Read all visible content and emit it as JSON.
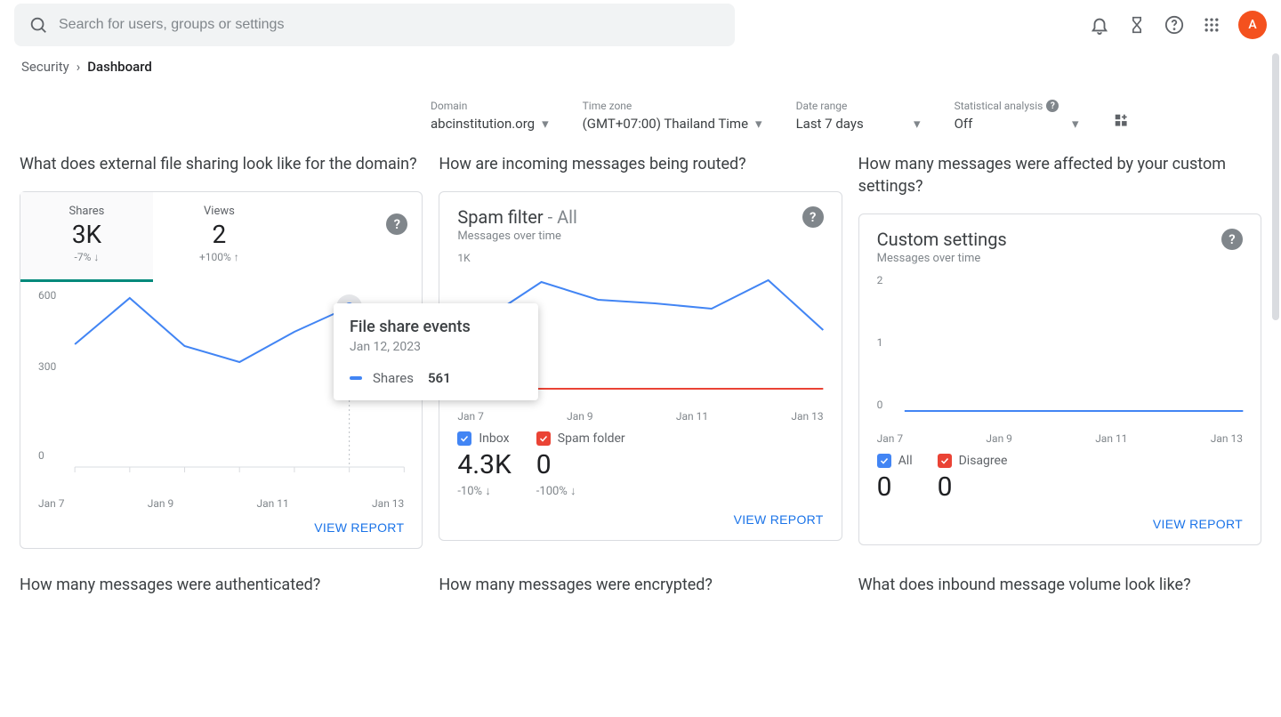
{
  "header": {
    "search_placeholder": "Search for users, groups or settings",
    "avatar_letter": "A"
  },
  "breadcrumb": {
    "parent": "Security",
    "current": "Dashboard"
  },
  "filters": {
    "domain": {
      "label": "Domain",
      "value": "abcinstitution.org"
    },
    "timezone": {
      "label": "Time zone",
      "value": "(GMT+07:00) Thailand Time"
    },
    "daterange": {
      "label": "Date range",
      "value": "Last 7 days"
    },
    "stats": {
      "label": "Statistical analysis",
      "value": "Off"
    }
  },
  "cards": {
    "fileSharing": {
      "question": "What does external file sharing look like for the domain?",
      "tabs": [
        {
          "label": "Shares",
          "value": "3K",
          "delta": "-7% ↓"
        },
        {
          "label": "Views",
          "value": "2",
          "delta": "+100% ↑"
        }
      ],
      "xTicks": [
        "Jan 7",
        "Jan 9",
        "Jan 11",
        "Jan 13"
      ],
      "yTicks": [
        "600",
        "300",
        "0"
      ],
      "view": "VIEW REPORT",
      "tooltip": {
        "title": "File share events",
        "date": "Jan 12, 2023",
        "series": "Shares",
        "value": "561"
      }
    },
    "spam": {
      "question": "How are incoming messages being routed?",
      "title": "Spam filter",
      "suffix": " - All",
      "sub": "Messages over time",
      "yTicks": [
        "1K"
      ],
      "xTicks": [
        "Jan 7",
        "Jan 9",
        "Jan 11",
        "Jan 13"
      ],
      "legend": [
        {
          "name": "Inbox",
          "value": "4.3K",
          "delta": "-10% ↓",
          "color": "blue"
        },
        {
          "name": "Spam folder",
          "value": "0",
          "delta": "-100% ↓",
          "color": "red"
        }
      ],
      "view": "VIEW REPORT"
    },
    "custom": {
      "question": "How many messages were affected by your custom settings?",
      "title": "Custom settings",
      "sub": "Messages over time",
      "yTicks": [
        "2",
        "1",
        "0"
      ],
      "xTicks": [
        "Jan 7",
        "Jan 9",
        "Jan 11",
        "Jan 13"
      ],
      "legend": [
        {
          "name": "All",
          "value": "0",
          "color": "blue"
        },
        {
          "name": "Disagree",
          "value": "0",
          "color": "red"
        }
      ],
      "view": "VIEW REPORT"
    }
  },
  "row2": {
    "q1": "How many messages were authenticated?",
    "q2": "How many messages were encrypted?",
    "q3": "What does inbound message volume look like?"
  },
  "chart_data": [
    {
      "type": "line",
      "title": "File share events – Shares",
      "xlabel": "",
      "ylabel": "",
      "x": [
        "Jan 7",
        "Jan 8",
        "Jan 9",
        "Jan 10",
        "Jan 11",
        "Jan 12",
        "Jan 13"
      ],
      "series": [
        {
          "name": "Shares",
          "values": [
            420,
            590,
            420,
            360,
            470,
            561,
            400
          ]
        }
      ],
      "ylim": [
        0,
        600
      ]
    },
    {
      "type": "line",
      "title": "Spam filter – Messages over time",
      "x": [
        "Jan 7",
        "Jan 8",
        "Jan 9",
        "Jan 10",
        "Jan 11",
        "Jan 12",
        "Jan 13"
      ],
      "series": [
        {
          "name": "Inbox",
          "values": [
            500,
            760,
            640,
            630,
            600,
            790,
            430
          ]
        },
        {
          "name": "Spam folder",
          "values": [
            0,
            0,
            0,
            0,
            0,
            0,
            0
          ]
        }
      ],
      "ylim": [
        0,
        1000
      ]
    },
    {
      "type": "line",
      "title": "Custom settings – Messages over time",
      "x": [
        "Jan 7",
        "Jan 8",
        "Jan 9",
        "Jan 10",
        "Jan 11",
        "Jan 12",
        "Jan 13"
      ],
      "series": [
        {
          "name": "All",
          "values": [
            0,
            0,
            0,
            0,
            0,
            0,
            0
          ]
        },
        {
          "name": "Disagree",
          "values": [
            0,
            0,
            0,
            0,
            0,
            0,
            0
          ]
        }
      ],
      "ylim": [
        0,
        2
      ]
    }
  ]
}
